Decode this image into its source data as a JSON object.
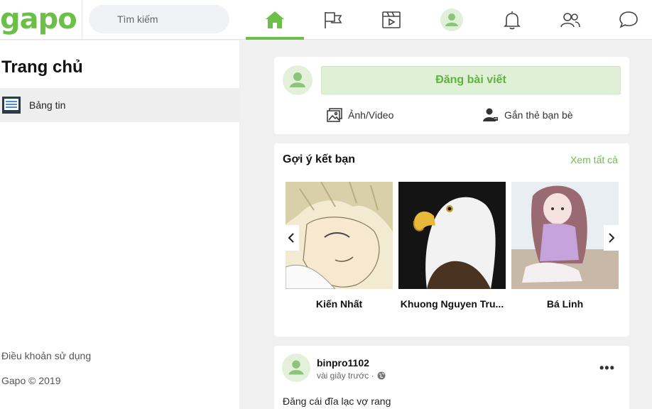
{
  "header": {
    "logo": "gapo",
    "search_placeholder": "Tìm kiếm",
    "nav_icons": [
      "home-icon",
      "flag-icon",
      "video-icon",
      "profile-icon",
      "bell-icon",
      "friends-icon",
      "chat-icon"
    ],
    "accent_color": "#6cc04a"
  },
  "sidebar": {
    "title": "Trang chủ",
    "items": [
      {
        "label": "Bảng tin",
        "icon": "newsfeed-icon"
      }
    ],
    "footer": {
      "terms": "Điều khoản sử dụng",
      "copyright": "Gapo © 2019"
    }
  },
  "composer": {
    "post_button": "Đăng bài viết",
    "photo_video": "Ảnh/Video",
    "tag_friends": "Gắn thẻ bạn bè"
  },
  "suggestions": {
    "title": "Gợi ý kết bạn",
    "see_all": "Xem tất cả",
    "friends": [
      {
        "name": "Kiến Nhất"
      },
      {
        "name": "Khuong Nguyen Tru..."
      },
      {
        "name": "Bá Linh"
      }
    ]
  },
  "post": {
    "username": "binpro1102",
    "time": "vài giây trước ·",
    "text": "Đăng cái đĩa lạc vợ rang",
    "more": "•••"
  }
}
